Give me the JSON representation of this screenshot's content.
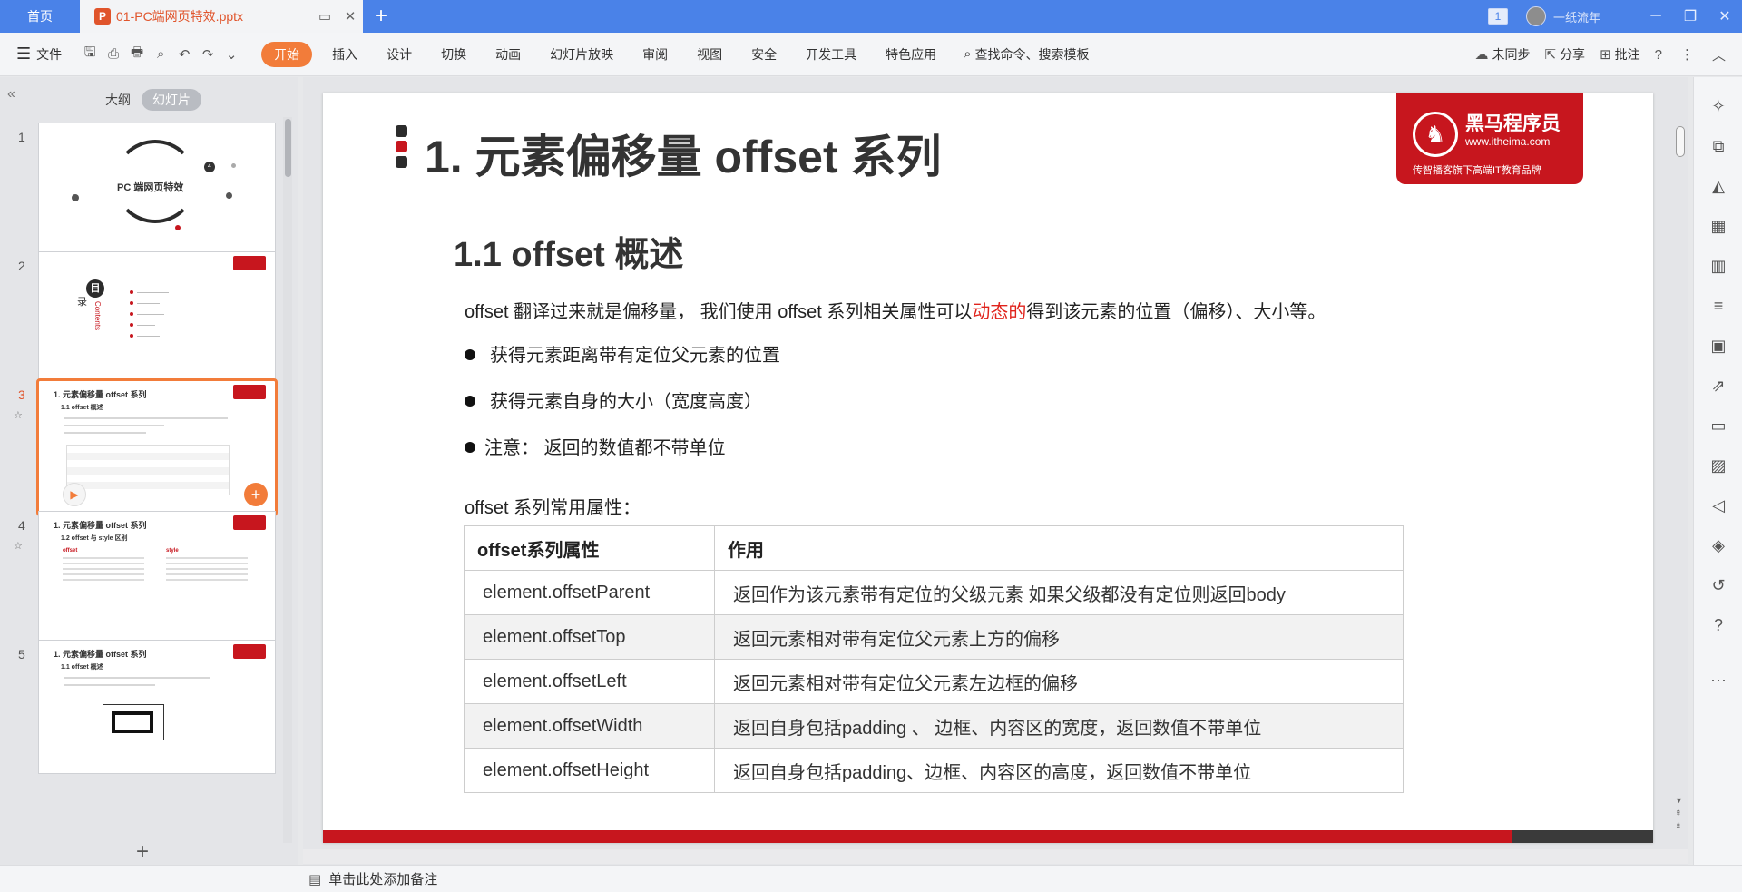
{
  "titlebar": {
    "home_tab": "首页",
    "doc_tab": "01-PC端网页特效.pptx",
    "doc_icon": "P",
    "badge": "1",
    "user": "一纸流年"
  },
  "ribbon": {
    "file": "文件",
    "tabs": [
      "开始",
      "插入",
      "设计",
      "切换",
      "动画",
      "幻灯片放映",
      "审阅",
      "视图",
      "安全",
      "开发工具",
      "特色应用"
    ],
    "search": "查找命令、搜索模板",
    "sync": "未同步",
    "share": "分享",
    "comment": "批注"
  },
  "panel": {
    "tab_outline": "大纲",
    "tab_slides": "幻灯片"
  },
  "thumbnails": {
    "t1": {
      "num": "1",
      "title": "PC 端网页特效",
      "badge": "4"
    },
    "t2": {
      "num": "2",
      "mu": "目",
      "lu": "录",
      "contents": "Contents"
    },
    "t3": {
      "num": "3",
      "title": "1. 元素偏移量 offset 系列",
      "sub": "1.1 offset 概述"
    },
    "t4": {
      "num": "4",
      "title": "1. 元素偏移量 offset 系列",
      "sub": "1.2 offset 与 style 区别",
      "col1": "offset",
      "col2": "style"
    },
    "t5": {
      "num": "5",
      "title": "1. 元素偏移量 offset 系列",
      "sub": "1.1 offset 概述"
    }
  },
  "slide": {
    "title": "1. 元素偏移量 offset 系列",
    "logo_name": "黑马程序员",
    "logo_url": "www.itheima.com",
    "logo_tag": "传智播客旗下高端IT教育品牌",
    "subtitle": "1.1 offset 概述",
    "intro_a": "offset 翻译过来就是偏移量， 我们使用 offset 系列相关属性可以",
    "intro_highlight": "动态的",
    "intro_b": "得到该元素的位置（偏移）、大小等。",
    "bullets": [
      "获得元素距离带有定位父元素的位置",
      "获得元素自身的大小（宽度高度）",
      "注意： 返回的数值都不带单位"
    ],
    "table_label": "offset 系列常用属性：",
    "table_head": [
      "offset系列属性",
      "作用"
    ],
    "table_rows": [
      [
        "element.offsetParent",
        "返回作为该元素带有定位的父级元素 如果父级都没有定位则返回body"
      ],
      [
        "element.offsetTop",
        "返回元素相对带有定位父元素上方的偏移"
      ],
      [
        "element.offsetLeft",
        "返回元素相对带有定位父元素左边框的偏移"
      ],
      [
        "element.offsetWidth",
        "返回自身包括padding 、 边框、内容区的宽度，返回数值不带单位"
      ],
      [
        "element.offsetHeight",
        "返回自身包括padding、边框、内容区的高度，返回数值不带单位"
      ]
    ]
  },
  "statusbar": {
    "note": "单击此处添加备注"
  },
  "colors": {
    "titlebar": "#4a82e8",
    "accent": "#f27c3a",
    "brand_red": "#c7161e"
  }
}
